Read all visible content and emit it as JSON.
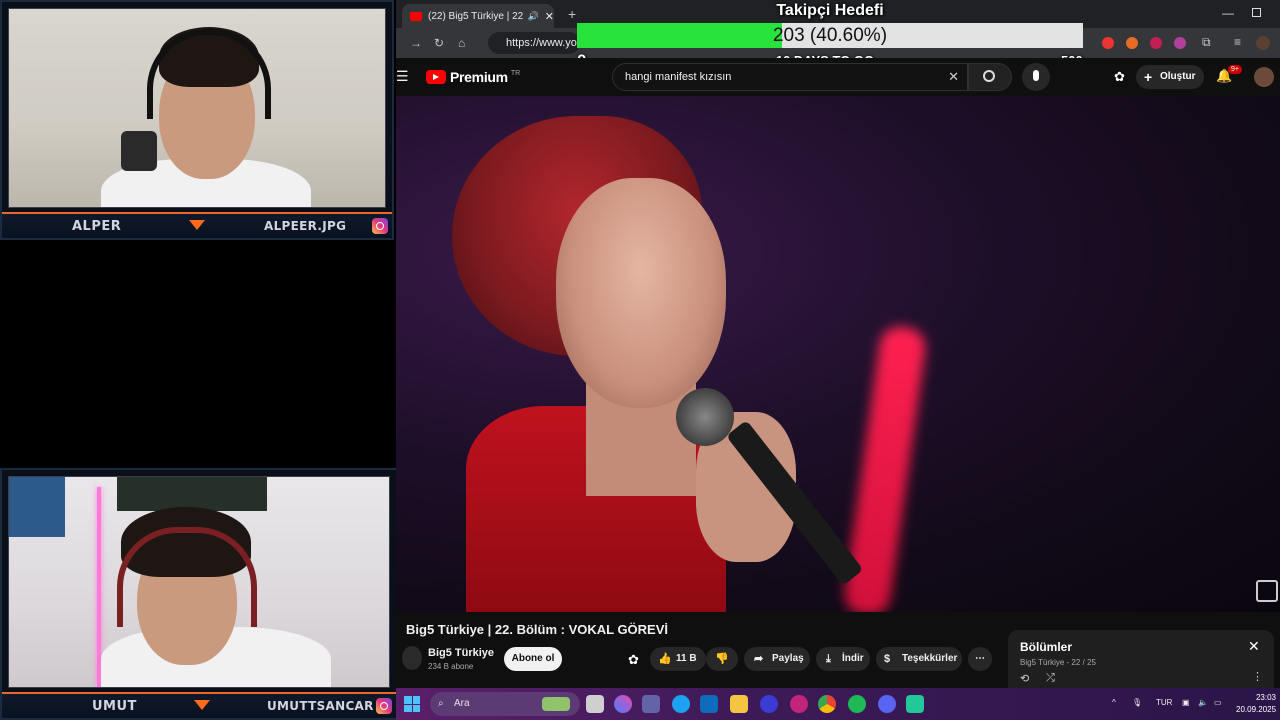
{
  "cams": {
    "top": {
      "name_left": "ALPER",
      "name_right": "ALPEER.JPG"
    },
    "bottom": {
      "name_left": "UMUT",
      "name_right": "UMUTTSANCAR"
    }
  },
  "browser": {
    "tab_title": "(22) Big5 Türkiye | 22. Bölüm",
    "url": "https://www.yout"
  },
  "goal": {
    "title": "Takipçi Hedefi",
    "current_text": "203 (40.60%)",
    "progress": 0.406,
    "min": "0",
    "max": "500",
    "days_left": "10 DAYS TO GO"
  },
  "youtube": {
    "logo": "Premium",
    "logo_region": "TR",
    "search_value": "hangi manifest kızısın",
    "create_label": "Oluştur",
    "notif_badge": "9+"
  },
  "video": {
    "title": "Big5 Türkiye | 22. Bölüm : VOKAL GÖREVİ",
    "channel": "Big5 Türkiye",
    "subscribers": "234 B abone",
    "subscribe_label": "Abone ol",
    "likes": "11 B",
    "share_label": "Paylaş",
    "download_label": "İndir",
    "thanks_label": "Teşekkürler",
    "more_label": "⋯"
  },
  "chapters": {
    "title": "Bölümler",
    "subtitle": "Big5 Türkiye - 22 / 25"
  },
  "taskbar": {
    "search_placeholder": "Ara",
    "lang": "TUR",
    "time": "23:03",
    "date": "20.09.2025"
  },
  "colors": {
    "goal_fill": "#27e33c",
    "cam_accent": "#ff6a1a",
    "yt_red": "#ff0000"
  }
}
